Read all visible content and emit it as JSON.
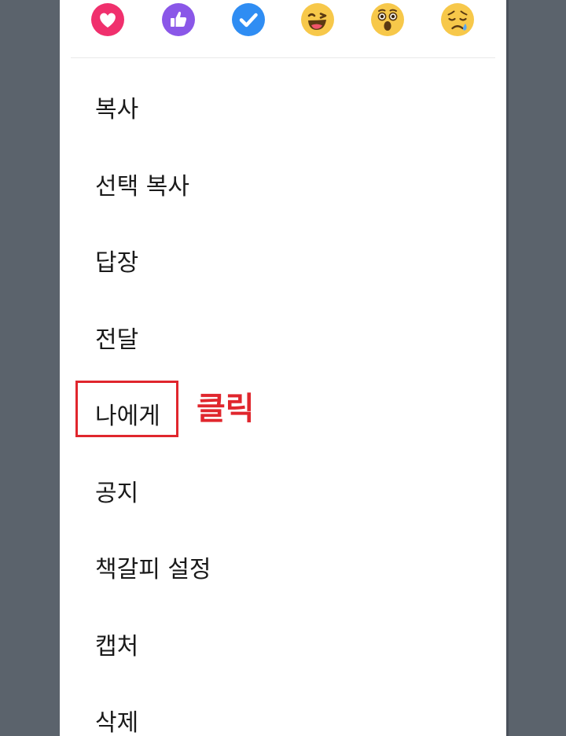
{
  "reactions": [
    {
      "icon": "heart-reaction-icon",
      "color": "#f0306d"
    },
    {
      "icon": "thumbs-up-reaction-icon",
      "color": "#8a57e8"
    },
    {
      "icon": "check-reaction-icon",
      "color": "#2f8df3"
    },
    {
      "icon": "laughing-face-reaction-icon",
      "color": "#f7c84a"
    },
    {
      "icon": "surprised-face-reaction-icon",
      "color": "#f7c84a"
    },
    {
      "icon": "sad-face-reaction-icon",
      "color": "#f7c84a"
    }
  ],
  "menu": {
    "items": [
      {
        "label": "복사"
      },
      {
        "label": "선택 복사"
      },
      {
        "label": "답장"
      },
      {
        "label": "전달"
      },
      {
        "label": "나에게"
      },
      {
        "label": "공지"
      },
      {
        "label": "책갈피 설정"
      },
      {
        "label": "캡처"
      },
      {
        "label": "삭제"
      }
    ]
  },
  "annotation": {
    "text": "클릭",
    "color": "#e0262d"
  }
}
